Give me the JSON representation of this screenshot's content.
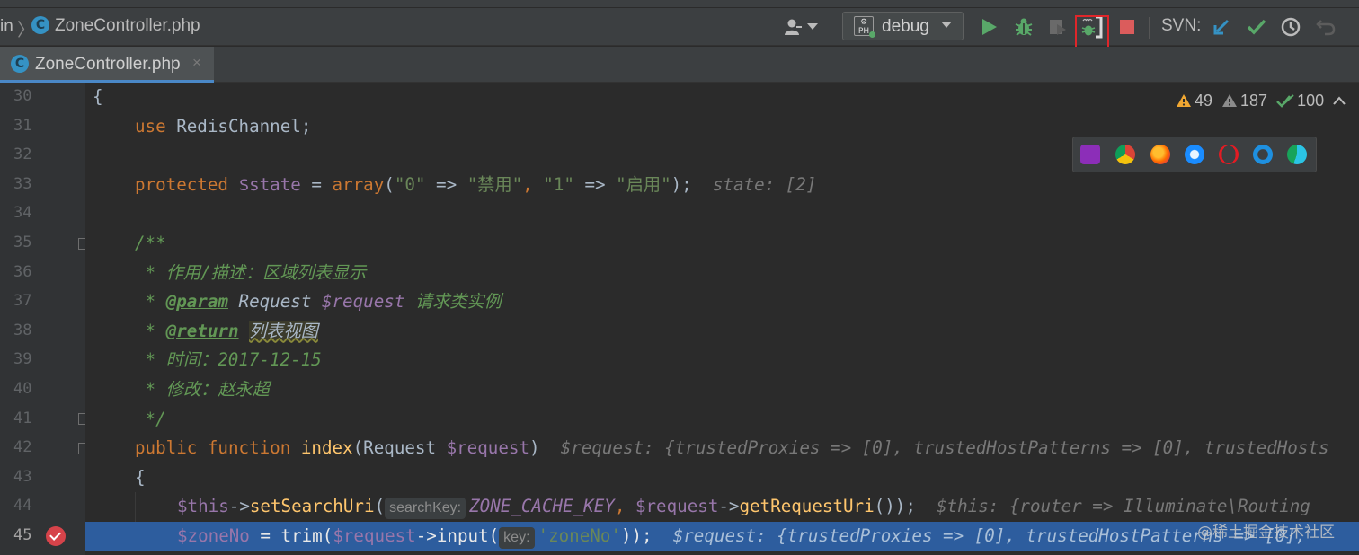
{
  "breadcrumb": {
    "prev": "in",
    "separator": "〉",
    "file": "ZoneController.php"
  },
  "toolbar": {
    "run_config": "debug",
    "svn_label": "SVN:"
  },
  "tabs": [
    {
      "label": "ZoneController.php",
      "close": "×"
    }
  ],
  "inspection": {
    "warnings": "49",
    "weak_warnings": "187",
    "ok": "100"
  },
  "gutter": {
    "lines": [
      "30",
      "31",
      "32",
      "33",
      "34",
      "35",
      "36",
      "37",
      "38",
      "39",
      "40",
      "41",
      "42",
      "43",
      "44",
      "45"
    ]
  },
  "code": {
    "l30": "{",
    "l31_kw": "use",
    "l31_text": " RedisChannel;",
    "l33_kw": "protected",
    "l33_var": " $state",
    "l33_eq": " = ",
    "l33_fn": "array",
    "l33_p1": "(",
    "l33_s1": "\"0\"",
    "l33_arrow1": " => ",
    "l33_s2": "\"禁用\"",
    "l33_c1": ", ",
    "l33_s3": "\"1\"",
    "l33_arrow2": " => ",
    "l33_s4": "\"启用\"",
    "l33_end": ");",
    "l33_inline": "  state: [2]",
    "l35": "/**",
    "l36": " * 作用/描述：区域列表显示",
    "l37_star": " * ",
    "l37_tag": "@param",
    "l37_type": " Request",
    "l37_var": " $request",
    "l37_desc": " 请求类实例",
    "l38_star": " * ",
    "l38_tag": "@return",
    "l38_sp": " ",
    "l38_desc": "列表视图",
    "l39": " * 时间：2017-12-15",
    "l40": " * 修改：赵永超",
    "l41": " */",
    "l42_kw": "public function",
    "l42_sp": " ",
    "l42_fn": "index",
    "l42_p": "(Request ",
    "l42_var": "$request",
    "l42_end": ")",
    "l42_inline": "  $request: {trustedProxies => [0], trustedHostPatterns => [0], trustedHosts",
    "l43": "{",
    "l44_var": "$this",
    "l44_arrow": "->",
    "l44_fn": "setSearchUri",
    "l44_p": "(",
    "l44_hint": "searchKey:",
    "l44_const": "ZONE_CACHE_KEY",
    "l44_c": ", ",
    "l44_var2": "$request",
    "l44_arrow2": "->",
    "l44_fn2": "getRequestUri",
    "l44_end": "());",
    "l44_inline": "  $this: {router => Illuminate\\Routing",
    "l45_var": "$zoneNo",
    "l45_eq": " = ",
    "l45_fn": "trim",
    "l45_p": "(",
    "l45_var2": "$request",
    "l45_arrow": "->",
    "l45_fn2": "input",
    "l45_p2": "(",
    "l45_hint": "key:",
    "l45_str": "'zoneNo'",
    "l45_end": "));",
    "l45_inline": "  $request: {trustedProxies => [0], trustedHostPatterns => [0],"
  },
  "watermark": "@稀土掘金技术社区",
  "colors": {
    "accent": "#4a88c7",
    "run_green": "#59a869",
    "stop_red": "#db5c5c",
    "highlight_box": "#e0262a",
    "exec_line": "#2d5d9e"
  }
}
